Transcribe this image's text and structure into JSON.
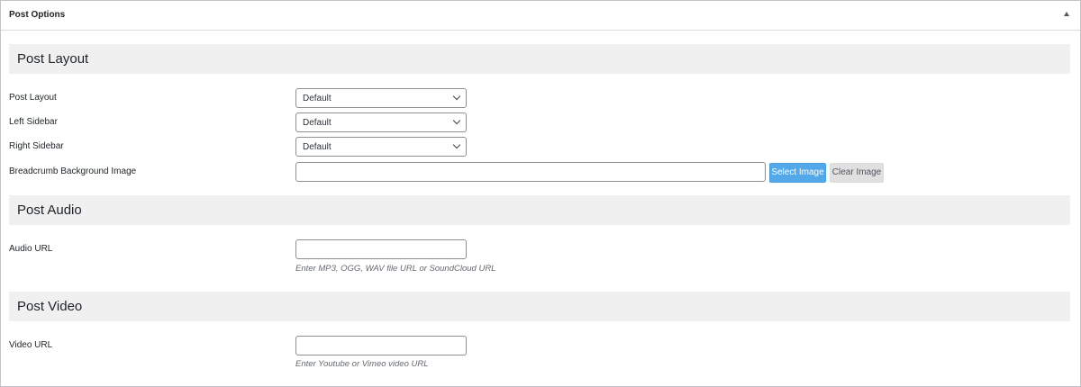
{
  "metabox": {
    "title": "Post Options"
  },
  "sections": {
    "layout": {
      "title": "Post Layout",
      "post_layout": {
        "label": "Post Layout",
        "value": "Default"
      },
      "left_sidebar": {
        "label": "Left Sidebar",
        "value": "Default"
      },
      "right_sidebar": {
        "label": "Right Sidebar",
        "value": "Default"
      },
      "breadcrumb_image": {
        "label": "Breadcrumb Background Image",
        "value": "",
        "select_label": "Select Image",
        "clear_label": "Clear Image"
      }
    },
    "audio": {
      "title": "Post Audio",
      "audio_url": {
        "label": "Audio URL",
        "value": "",
        "help": "Enter MP3, OGG, WAV file URL or SoundCloud URL"
      }
    },
    "video": {
      "title": "Post Video",
      "video_url": {
        "label": "Video URL",
        "value": "",
        "help": "Enter Youtube or Vimeo video URL"
      }
    }
  },
  "icons": {
    "toggle": "triangle-up-icon",
    "select_arrow": "chevron-down-icon"
  },
  "colors": {
    "primary_button": "#52a8e8",
    "section_bg": "#f0f0f1",
    "border": "#c3c4c7"
  }
}
